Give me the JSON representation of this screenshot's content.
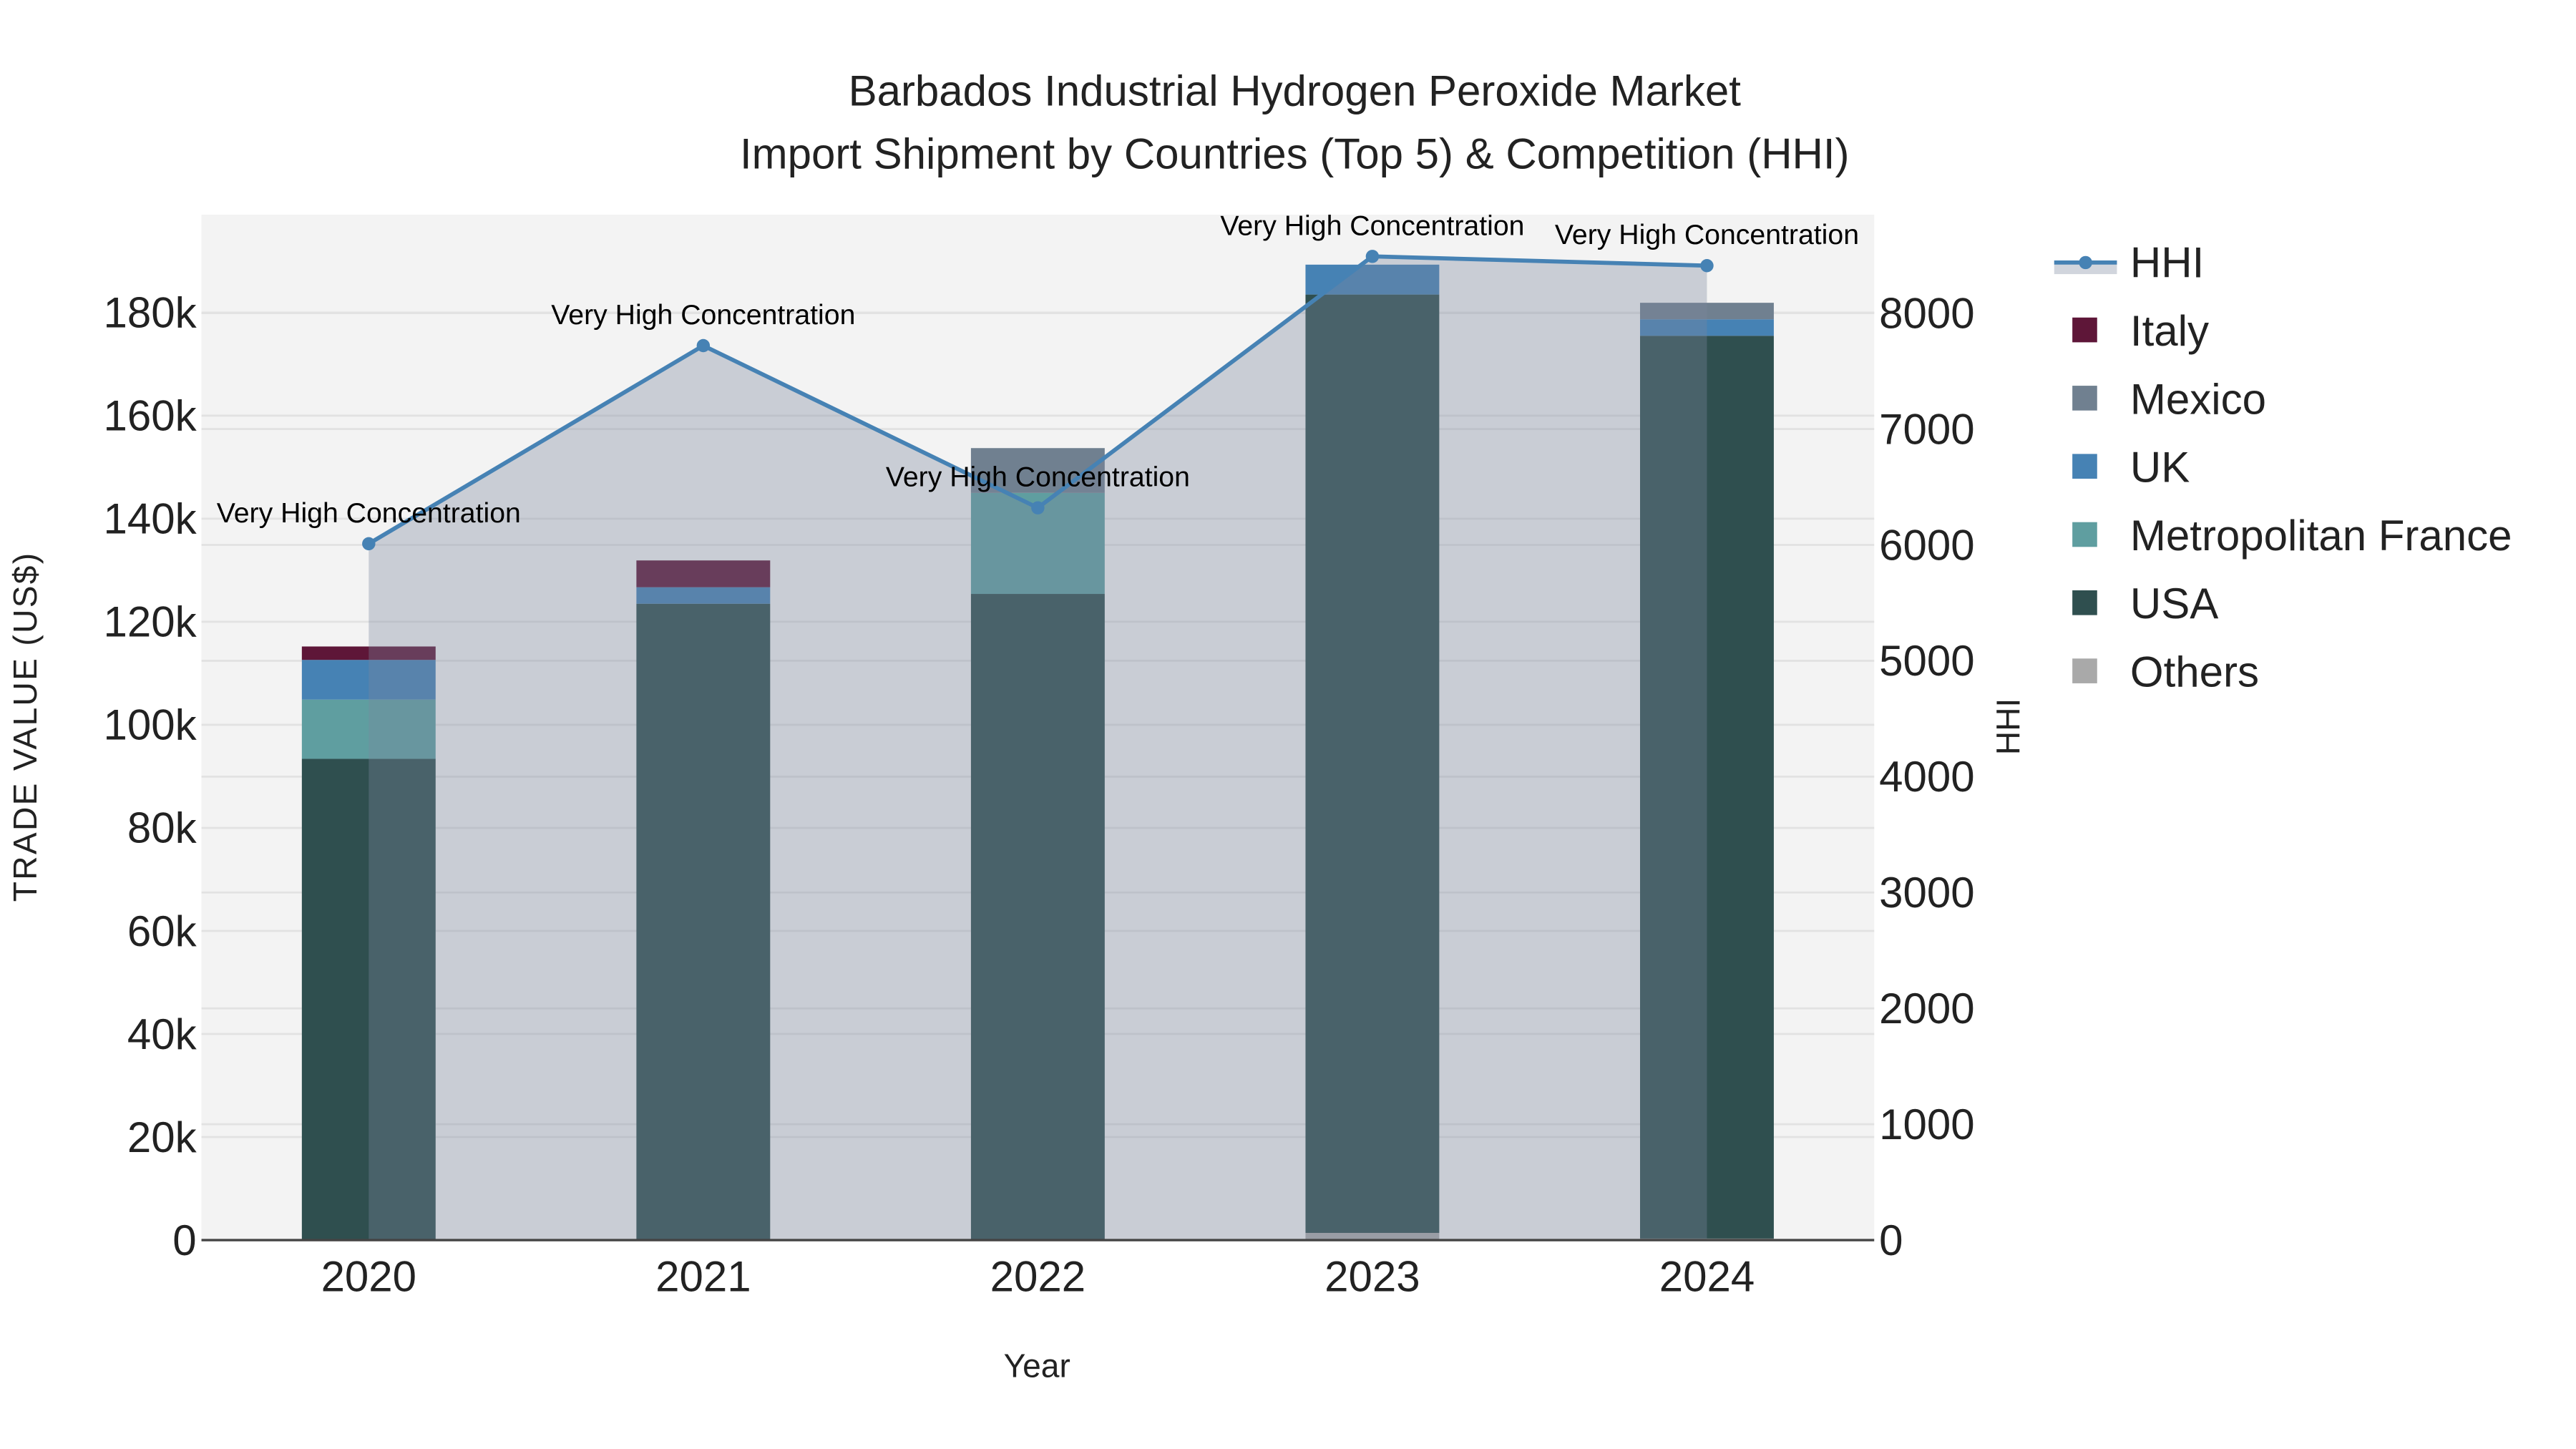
{
  "chart_data": {
    "type": "bar",
    "title": "Barbados Industrial Hydrogen Peroxide Market",
    "subtitle": "Import Shipment by Countries (Top 5) & Competition (HHI)",
    "xlabel": "Year",
    "ylabel": "TRADE VALUE (US$)",
    "y2label": "HHI",
    "categories": [
      "2020",
      "2021",
      "2022",
      "2023",
      "2024"
    ],
    "ylim": [
      0,
      199000
    ],
    "y2lim": [
      0,
      8850
    ],
    "yticks": [
      0,
      20000,
      40000,
      60000,
      80000,
      100000,
      120000,
      140000,
      160000,
      180000
    ],
    "ytick_labels": [
      "0",
      "20k",
      "40k",
      "60k",
      "80k",
      "100k",
      "120k",
      "140k",
      "160k",
      "180k"
    ],
    "y2ticks": [
      0,
      1000,
      2000,
      3000,
      4000,
      5000,
      6000,
      7000,
      8000
    ],
    "y2tick_labels": [
      "0",
      "1000",
      "2000",
      "3000",
      "4000",
      "5000",
      "6000",
      "7000",
      "8000"
    ],
    "grid": true,
    "stacked": true,
    "series": [
      {
        "name": "Others",
        "color": "#A9A9A9",
        "values": [
          0,
          0,
          0,
          1400,
          300
        ]
      },
      {
        "name": "USA",
        "color": "#2F4F4F",
        "values": [
          93400,
          123500,
          125400,
          182100,
          175200
        ]
      },
      {
        "name": "Metropolitan France",
        "color": "#5F9EA0",
        "values": [
          11500,
          0,
          19600,
          0,
          0
        ]
      },
      {
        "name": "UK",
        "color": "#4682B4",
        "values": [
          7700,
          3200,
          0,
          5800,
          3200
        ]
      },
      {
        "name": "Mexico",
        "color": "#708090",
        "values": [
          0,
          0,
          8700,
          0,
          3200
        ]
      },
      {
        "name": "Italy",
        "color": "#5E1638",
        "values": [
          2600,
          5200,
          0,
          0,
          0
        ]
      }
    ],
    "hhi": {
      "name": "HHI",
      "color": "#4682B4",
      "values": [
        6010,
        7720,
        6320,
        8490,
        8410
      ],
      "annotations": [
        "Very High Concentration",
        "Very High Concentration",
        "Very High Concentration",
        "Very High Concentration",
        "Very High Concentration"
      ]
    },
    "legend": {
      "placement": "right",
      "items": [
        "HHI",
        "Italy",
        "Mexico",
        "UK",
        "Metropolitan France",
        "USA",
        "Others"
      ]
    }
  }
}
